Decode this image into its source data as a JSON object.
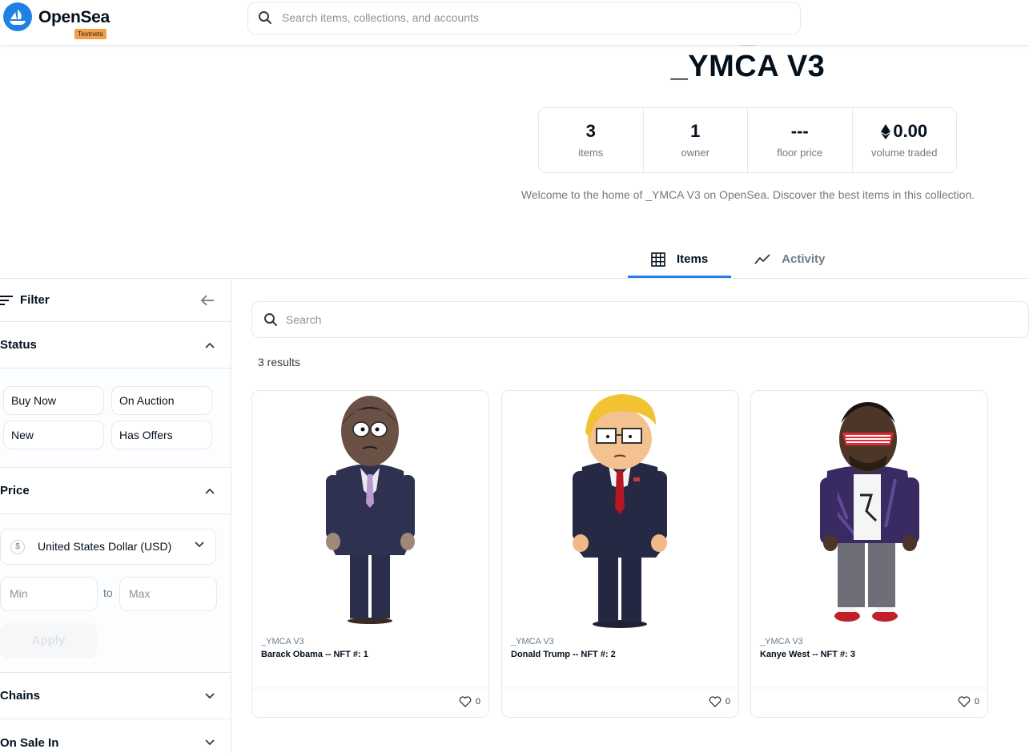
{
  "header": {
    "brand": "OpenSea",
    "badge": "Testnets",
    "search_placeholder": "Search items, collections, and accounts"
  },
  "collection": {
    "title": "_YMCA V3",
    "stats": [
      {
        "value": "3",
        "label": "items"
      },
      {
        "value": "1",
        "label": "owner"
      },
      {
        "value": "---",
        "label": "floor price"
      },
      {
        "value": "0.00",
        "label": "volume traded",
        "icon": "eth-icon"
      }
    ],
    "description": "Welcome to the home of _YMCA V3 on OpenSea. Discover the best items in this collection."
  },
  "tabs": [
    {
      "label": "Items",
      "icon": "grid-icon",
      "active": true
    },
    {
      "label": "Activity",
      "icon": "activity-chart-icon",
      "active": false
    }
  ],
  "sidebar": {
    "filter_label": "Filter",
    "status": {
      "label": "Status",
      "options": [
        "Buy Now",
        "On Auction",
        "New",
        "Has Offers"
      ]
    },
    "price": {
      "label": "Price",
      "currency": "United States Dollar (USD)",
      "currency_symbol": "$",
      "min_placeholder": "Min",
      "to_label": "to",
      "max_placeholder": "Max",
      "apply_label": "Apply"
    },
    "chains_label": "Chains",
    "on_sale_label": "On Sale In"
  },
  "main": {
    "search_placeholder": "Search",
    "results_text": "3 results",
    "items": [
      {
        "collection": "_YMCA V3",
        "name": "Barack Obama -- NFT #: 1",
        "likes": "0"
      },
      {
        "collection": "_YMCA V3",
        "name": "Donald Trump -- NFT #: 2",
        "likes": "0"
      },
      {
        "collection": "_YMCA V3",
        "name": "Kanye West -- NFT #: 3",
        "likes": "0"
      }
    ]
  },
  "colors": {
    "accent": "#2081e2",
    "badge": "#f0a04b",
    "text": "#04111d",
    "muted": "#707a83"
  }
}
